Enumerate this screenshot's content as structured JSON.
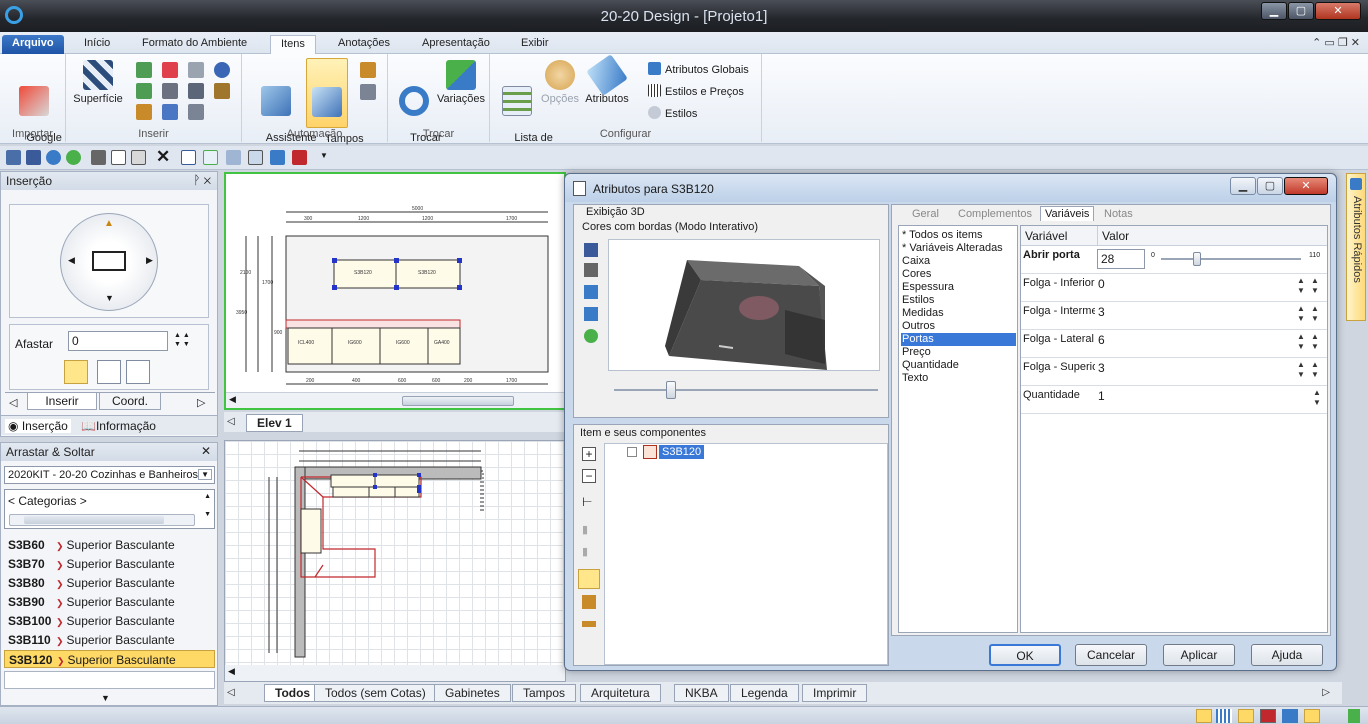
{
  "window": {
    "title": "20-20 Design - [Projeto1]"
  },
  "menu": {
    "tabs": [
      "Arquivo",
      "Início",
      "Formato do Ambiente",
      "Itens",
      "Anotações",
      "Apresentação",
      "Exibir"
    ]
  },
  "ribbon": {
    "importar": {
      "label": "Importar",
      "google": "Google\nSketchup"
    },
    "inserir": {
      "label": "Inserir",
      "superficie": "Superfície"
    },
    "automacao": {
      "label": "Automação",
      "assistente": "Assistente\nde Tampos",
      "tampos": "Tampos\ne Perfis"
    },
    "trocar": {
      "label": "Trocar",
      "trocar_itens": "Trocar\nItens...",
      "variacoes": "Variações"
    },
    "configurar": {
      "label": "Configurar",
      "lista": "Lista de\nItens",
      "opcoes": "Opções",
      "atributos": "Atributos",
      "globais": "Atributos Globais",
      "estilos_precos": "Estilos e Preços",
      "estilos": "Estilos"
    }
  },
  "insercao_panel": {
    "title": "Inserção",
    "afastar_label": "Afastar",
    "afastar_value": "0",
    "tab_inserir": "Inserir",
    "tab_coord": "Coord.",
    "bottom_tab1": "Inserção",
    "bottom_tab2": "Informação"
  },
  "drag_panel": {
    "title": "Arrastar & Soltar",
    "catalog": "2020KIT - 20-20 Cozinhas e Banheiros",
    "categories": "< Categorias >",
    "items": [
      {
        "code": "S3B60",
        "desc": "Superior Basculante"
      },
      {
        "code": "S3B70",
        "desc": "Superior Basculante"
      },
      {
        "code": "S3B80",
        "desc": "Superior Basculante"
      },
      {
        "code": "S3B90",
        "desc": "Superior Basculante"
      },
      {
        "code": "S3B100",
        "desc": "Superior Basculante"
      },
      {
        "code": "S3B110",
        "desc": "Superior Basculante"
      },
      {
        "code": "S3B120",
        "desc": "Superior Basculante"
      }
    ]
  },
  "elev_tab": "Elev 1",
  "drawing_labels": {
    "w1": "5000",
    "w2": "300",
    "w3": "1200",
    "w4": "1200",
    "w5": "1700",
    "c1": "S3B120",
    "c2": "S3B120",
    "b1": "ICL400",
    "b2": "IG600",
    "b3": "IG600",
    "b4": "GA400",
    "h1": "2100",
    "h2": "1700",
    "h3": "900",
    "side": "3950",
    "bottom_dims": [
      "200",
      "400",
      "600",
      "600",
      "200",
      "1700"
    ]
  },
  "bottom_tabs": [
    "Todos",
    "Todos (sem Cotas)",
    "Gabinetes",
    "Tampos",
    "Arquitetura",
    "NKBA",
    "Legenda",
    "Imprimir"
  ],
  "side_panel": {
    "label": "Atributos Rápidos"
  },
  "dialog": {
    "title": "Atributos para S3B120",
    "exibicao_3d": "Exibição 3D",
    "modo": "Cores com bordas (Modo Interativo)",
    "componentes": "Item e seus componentes",
    "tree_item": "S3B120",
    "tabs": [
      "Geral",
      "Complementos",
      "Variáveis",
      "Notas"
    ],
    "categories": [
      "* Todos os items",
      "* Variáveis Alteradas",
      "Caixa",
      "Cores",
      "Espessura",
      "Estilos",
      "Medidas",
      "Outros",
      "Portas",
      "Preço",
      "Quantidade",
      "Texto"
    ],
    "selected_category": "Portas",
    "col_var": "Variável",
    "col_val": "Valor",
    "vars": [
      {
        "name": "Abrir porta",
        "value": "28",
        "slider_min": "0",
        "slider_max": "110"
      },
      {
        "name": "Folga - Inferior",
        "value": "0"
      },
      {
        "name": "Folga - Intermediária",
        "value": "3"
      },
      {
        "name": "Folga - Lateral",
        "value": "6"
      },
      {
        "name": "Folga - Superior",
        "value": "3"
      },
      {
        "name": "Quantidade",
        "value": "1"
      }
    ],
    "buttons": {
      "ok": "OK",
      "cancel": "Cancelar",
      "apply": "Aplicar",
      "help": "Ajuda"
    }
  },
  "colors": {
    "accent": "#1e54a6",
    "selection": "#ffd966",
    "selected_cat": "#3a78d8"
  }
}
